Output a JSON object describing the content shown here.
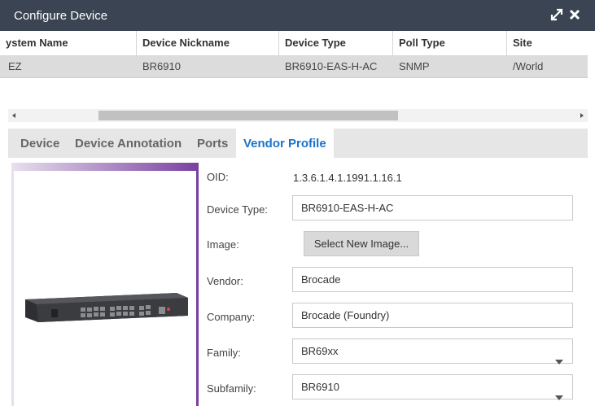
{
  "window": {
    "title": "Configure Device",
    "expand_icon": "expand-arrows-icon",
    "close_icon": "close-icon"
  },
  "grid": {
    "columns": [
      "ystem Name",
      "Device Nickname",
      "Device Type",
      "Poll Type",
      "Site"
    ],
    "rows": [
      [
        "EZ",
        "BR6910",
        "BR6910-EAS-H-AC",
        "SNMP",
        "/World"
      ]
    ]
  },
  "tabs": [
    {
      "label": "Device",
      "active": false
    },
    {
      "label": "Device Annotation",
      "active": false
    },
    {
      "label": "Ports",
      "active": false
    },
    {
      "label": "Vendor Profile",
      "active": true
    }
  ],
  "vendor_profile": {
    "oid_label": "OID:",
    "oid_value": "1.3.6.1.4.1.1991.1.16.1",
    "device_type_label": "Device Type:",
    "device_type_value": "BR6910-EAS-H-AC",
    "image_label": "Image:",
    "select_image_button": "Select New Image...",
    "vendor_label": "Vendor:",
    "vendor_value": "Brocade",
    "company_label": "Company:",
    "company_value": "Brocade (Foundry)",
    "family_label": "Family:",
    "family_value": "BR69xx",
    "subfamily_label": "Subfamily:",
    "subfamily_value": "BR6910"
  },
  "colors": {
    "titlebar": "#3a4452",
    "active_tab": "#1a73c9",
    "image_frame": "#7a3fa0"
  }
}
